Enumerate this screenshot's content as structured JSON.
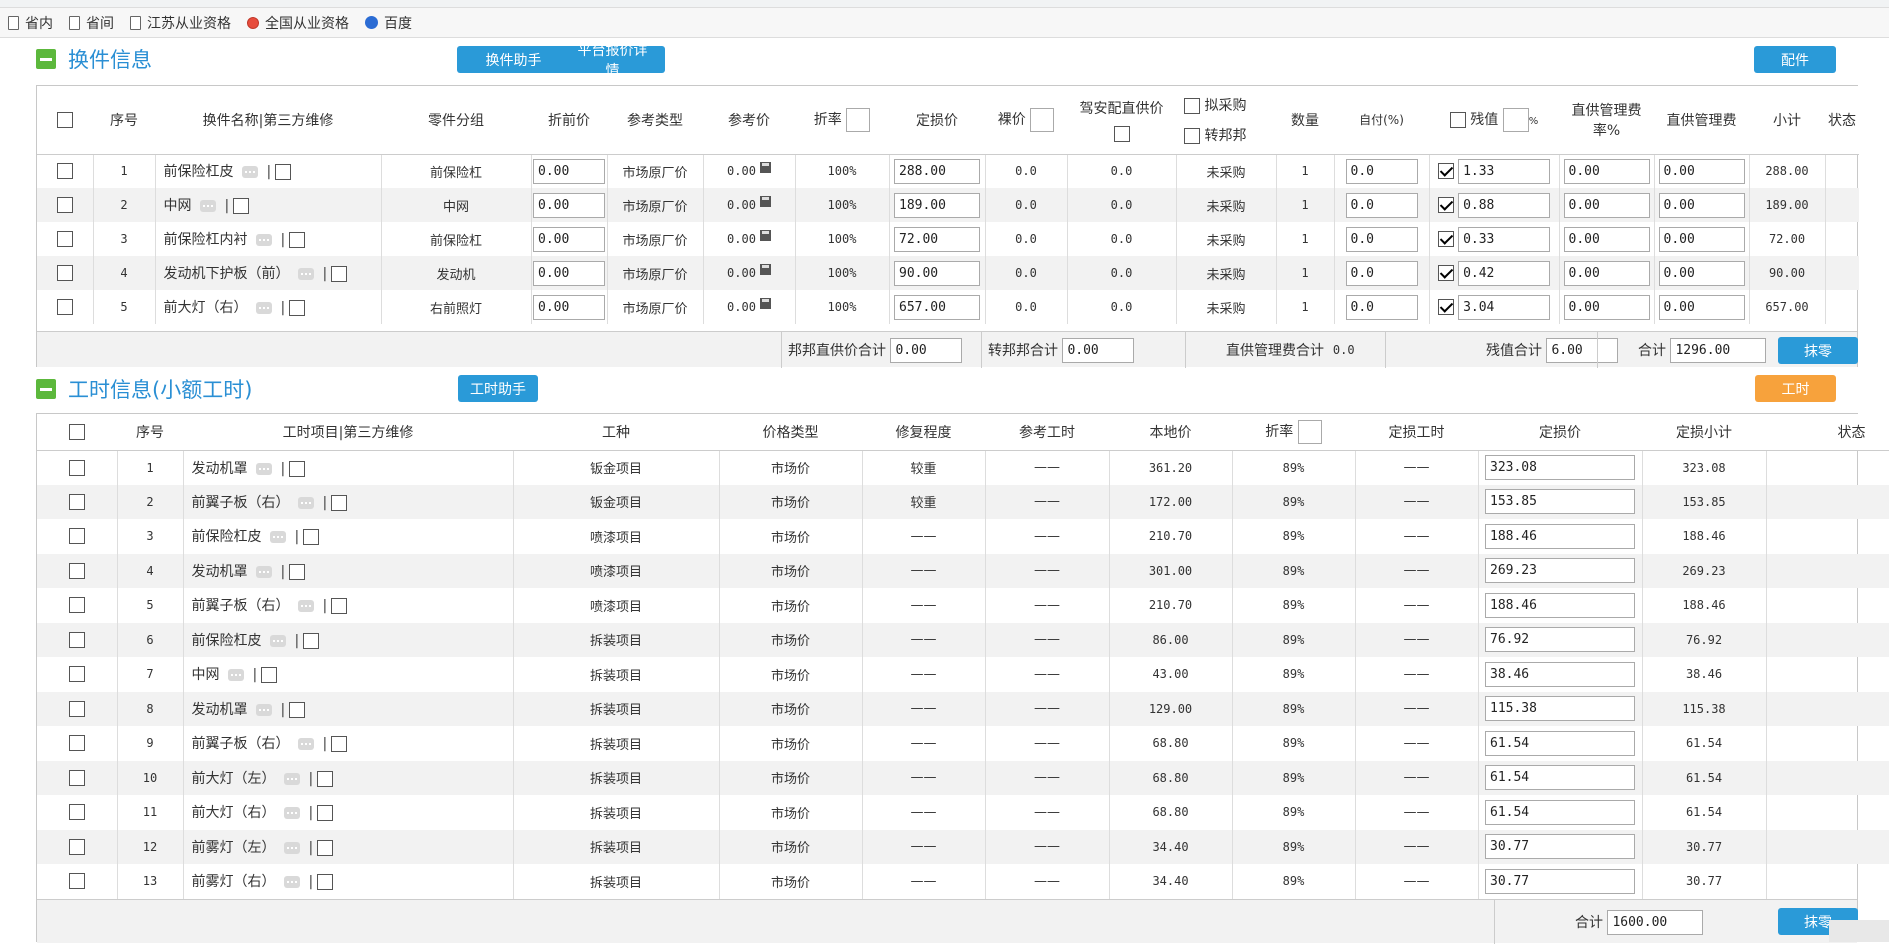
{
  "bookmarks": [
    {
      "label": "省内"
    },
    {
      "label": "省间"
    },
    {
      "label": "江苏从业资格"
    },
    {
      "label": "全国从业资格"
    },
    {
      "label": "百度"
    }
  ],
  "parts": {
    "title": "换件信息",
    "assist_btn": "换件助手",
    "platform_btn": "平台报价详情",
    "accessory_btn": "配件",
    "headers": {
      "seq": "序号",
      "name": "换件名称|第三方维修",
      "group": "零件分组",
      "pre_discount": "折前价",
      "ref_type": "参考类型",
      "ref_price": "参考价",
      "discount": "折率",
      "loss_price": "定损价",
      "bare_price": "裸价",
      "driving_supply": "驾安配直供价",
      "purchase": "拟采购",
      "transfer": "转邦邦",
      "qty": "数量",
      "self_pay": "自付(%)",
      "residual": "残值",
      "pct": "%",
      "mgmt_rate": "直供管理费率%",
      "mgmt_fee": "直供管理费",
      "subtotal": "小计",
      "status": "状态"
    },
    "rows": [
      {
        "seq": "1",
        "name": "前保险杠皮",
        "group": "前保险杠",
        "pre": "0.00",
        "ref_type": "市场原厂价",
        "ref_price": "0.00",
        "discount": "100%",
        "loss": "288.00",
        "bare": "0.0",
        "supply": "0.0",
        "purchase": "未采购",
        "qty": "1",
        "self": "0.0",
        "residual": "1.33",
        "rate": "0.00",
        "fee": "0.00",
        "subtotal": "288.00"
      },
      {
        "seq": "2",
        "name": "中网",
        "group": "中网",
        "pre": "0.00",
        "ref_type": "市场原厂价",
        "ref_price": "0.00",
        "discount": "100%",
        "loss": "189.00",
        "bare": "0.0",
        "supply": "0.0",
        "purchase": "未采购",
        "qty": "1",
        "self": "0.0",
        "residual": "0.88",
        "rate": "0.00",
        "fee": "0.00",
        "subtotal": "189.00"
      },
      {
        "seq": "3",
        "name": "前保险杠内衬",
        "group": "前保险杠",
        "pre": "0.00",
        "ref_type": "市场原厂价",
        "ref_price": "0.00",
        "discount": "100%",
        "loss": "72.00",
        "bare": "0.0",
        "supply": "0.0",
        "purchase": "未采购",
        "qty": "1",
        "self": "0.0",
        "residual": "0.33",
        "rate": "0.00",
        "fee": "0.00",
        "subtotal": "72.00"
      },
      {
        "seq": "4",
        "name": "发动机下护板（前）",
        "group": "发动机",
        "pre": "0.00",
        "ref_type": "市场原厂价",
        "ref_price": "0.00",
        "discount": "100%",
        "loss": "90.00",
        "bare": "0.0",
        "supply": "0.0",
        "purchase": "未采购",
        "qty": "1",
        "self": "0.0",
        "residual": "0.42",
        "rate": "0.00",
        "fee": "0.00",
        "subtotal": "90.00"
      },
      {
        "seq": "5",
        "name": "前大灯（右）",
        "group": "右前照灯",
        "pre": "0.00",
        "ref_type": "市场原厂价",
        "ref_price": "0.00",
        "discount": "100%",
        "loss": "657.00",
        "bare": "0.0",
        "supply": "0.0",
        "purchase": "未采购",
        "qty": "1",
        "self": "0.0",
        "residual": "3.04",
        "rate": "0.00",
        "fee": "0.00",
        "subtotal": "657.00"
      }
    ],
    "footer": {
      "bb_label": "邦邦直供价合计",
      "bb_value": "0.00",
      "tr_label": "转邦邦合计",
      "tr_value": "0.00",
      "mgmt_label": "直供管理费合计",
      "mgmt_value": "0.0",
      "res_label": "残值合计",
      "res_value": "6.00",
      "total_label": "合计",
      "total_value": "1296.00",
      "round_btn": "抹零"
    }
  },
  "labor": {
    "title": "工时信息(小额工时)",
    "assist_btn": "工时助手",
    "labor_btn": "工时",
    "headers": {
      "seq": "序号",
      "item": "工时项目|第三方维修",
      "type": "工种",
      "price_type": "价格类型",
      "degree": "修复程度",
      "ref_hours": "参考工时",
      "local": "本地价",
      "discount": "折率",
      "loss_hours": "定损工时",
      "loss_price": "定损价",
      "loss_sub": "定损小计",
      "status": "状态"
    },
    "rows": [
      {
        "seq": "1",
        "item": "发动机罩",
        "type": "钣金项目",
        "price_type": "市场价",
        "degree": "较重",
        "ref": "——",
        "local": "361.20",
        "disc": "89%",
        "hours": "——",
        "loss": "323.08",
        "sub": "323.08"
      },
      {
        "seq": "2",
        "item": "前翼子板（右）",
        "type": "钣金项目",
        "price_type": "市场价",
        "degree": "较重",
        "ref": "——",
        "local": "172.00",
        "disc": "89%",
        "hours": "——",
        "loss": "153.85",
        "sub": "153.85"
      },
      {
        "seq": "3",
        "item": "前保险杠皮",
        "type": "喷漆项目",
        "price_type": "市场价",
        "degree": "——",
        "ref": "——",
        "local": "210.70",
        "disc": "89%",
        "hours": "——",
        "loss": "188.46",
        "sub": "188.46"
      },
      {
        "seq": "4",
        "item": "发动机罩",
        "type": "喷漆项目",
        "price_type": "市场价",
        "degree": "——",
        "ref": "——",
        "local": "301.00",
        "disc": "89%",
        "hours": "——",
        "loss": "269.23",
        "sub": "269.23"
      },
      {
        "seq": "5",
        "item": "前翼子板（右）",
        "type": "喷漆项目",
        "price_type": "市场价",
        "degree": "——",
        "ref": "——",
        "local": "210.70",
        "disc": "89%",
        "hours": "——",
        "loss": "188.46",
        "sub": "188.46"
      },
      {
        "seq": "6",
        "item": "前保险杠皮",
        "type": "拆装项目",
        "price_type": "市场价",
        "degree": "——",
        "ref": "——",
        "local": "86.00",
        "disc": "89%",
        "hours": "——",
        "loss": "76.92",
        "sub": "76.92"
      },
      {
        "seq": "7",
        "item": "中网",
        "type": "拆装项目",
        "price_type": "市场价",
        "degree": "——",
        "ref": "——",
        "local": "43.00",
        "disc": "89%",
        "hours": "——",
        "loss": "38.46",
        "sub": "38.46"
      },
      {
        "seq": "8",
        "item": "发动机罩",
        "type": "拆装项目",
        "price_type": "市场价",
        "degree": "——",
        "ref": "——",
        "local": "129.00",
        "disc": "89%",
        "hours": "——",
        "loss": "115.38",
        "sub": "115.38"
      },
      {
        "seq": "9",
        "item": "前翼子板（右）",
        "type": "拆装项目",
        "price_type": "市场价",
        "degree": "——",
        "ref": "——",
        "local": "68.80",
        "disc": "89%",
        "hours": "——",
        "loss": "61.54",
        "sub": "61.54"
      },
      {
        "seq": "10",
        "item": "前大灯（左）",
        "type": "拆装项目",
        "price_type": "市场价",
        "degree": "——",
        "ref": "——",
        "local": "68.80",
        "disc": "89%",
        "hours": "——",
        "loss": "61.54",
        "sub": "61.54"
      },
      {
        "seq": "11",
        "item": "前大灯（右）",
        "type": "拆装项目",
        "price_type": "市场价",
        "degree": "——",
        "ref": "——",
        "local": "68.80",
        "disc": "89%",
        "hours": "——",
        "loss": "61.54",
        "sub": "61.54"
      },
      {
        "seq": "12",
        "item": "前雾灯（左）",
        "type": "拆装项目",
        "price_type": "市场价",
        "degree": "——",
        "ref": "——",
        "local": "34.40",
        "disc": "89%",
        "hours": "——",
        "loss": "30.77",
        "sub": "30.77"
      },
      {
        "seq": "13",
        "item": "前雾灯（右）",
        "type": "拆装项目",
        "price_type": "市场价",
        "degree": "——",
        "ref": "——",
        "local": "34.40",
        "disc": "89%",
        "hours": "——",
        "loss": "30.77",
        "sub": "30.77"
      }
    ],
    "footer": {
      "total_label": "合计",
      "total_value": "1600.00",
      "round_btn": "抹零"
    }
  },
  "colors": {
    "accent": "#2a9ad8",
    "title": "#2a8fd4",
    "orange": "#f7a23c",
    "green": "#5cb83c"
  }
}
